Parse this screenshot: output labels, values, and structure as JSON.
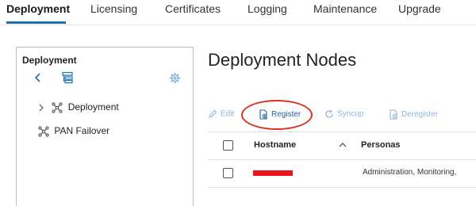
{
  "tabs": [
    {
      "label": "Deployment"
    },
    {
      "label": "Licensing"
    },
    {
      "label": "Certificates"
    },
    {
      "label": "Logging"
    },
    {
      "label": "Maintenance"
    },
    {
      "label": "Upgrade"
    }
  ],
  "active_tab": "Deployment",
  "left_panel": {
    "title": "Deployment",
    "tree": [
      {
        "label": "Deployment",
        "expandable": true
      },
      {
        "label": "PAN Failover",
        "expandable": false
      }
    ]
  },
  "main": {
    "title": "Deployment Nodes",
    "toolbar": {
      "edit": "Edit",
      "register": "Register",
      "syncup": "Syncup",
      "deregister": "Deregister"
    },
    "table": {
      "columns": {
        "hostname": "Hostname",
        "personas": "Personas"
      },
      "rows": [
        {
          "hostname": "",
          "personas": "Administration, Monitoring,"
        }
      ]
    }
  },
  "colors": {
    "accent": "#1f6fb5",
    "highlight_ring": "#d9331f",
    "redaction": "#e8151b"
  }
}
